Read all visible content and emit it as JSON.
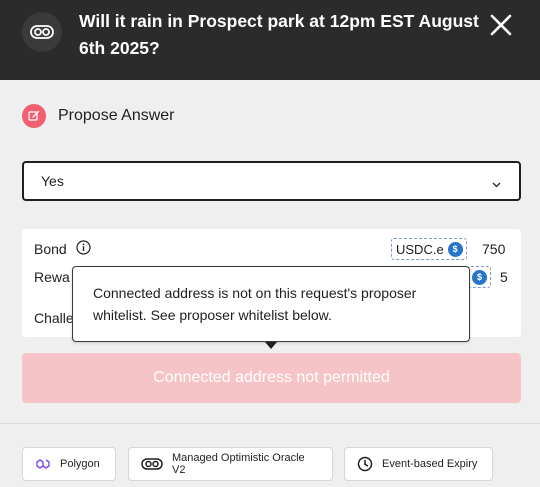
{
  "header": {
    "title": "Will it rain in Prospect park at 12pm EST August 6th 2025?",
    "logo_icon": "oracle-logo-icon",
    "close_icon": "close-icon"
  },
  "propose": {
    "label": "Propose Answer",
    "icon": "pencil-square-icon",
    "icon_color": "#f06070"
  },
  "answer_select": {
    "value": "Yes"
  },
  "info": {
    "bond_label": "Bond",
    "bond_token": "USDC.e",
    "bond_amount": "750",
    "reward_label": "Rewa",
    "reward_amount": "5",
    "challenge_label": "Challe"
  },
  "tooltip": {
    "text": "Connected address is not on this request's proposer whitelist. See proposer whitelist below."
  },
  "submit": {
    "label": "Connected address not permitted",
    "bg_color": "#f6c4c7"
  },
  "chips": [
    {
      "label": "Polygon",
      "icon": "polygon-icon"
    },
    {
      "label": "Managed Optimistic Oracle V2",
      "icon": "oracle-icon"
    },
    {
      "label": "Event-based Expiry",
      "icon": "clock-icon"
    }
  ],
  "colors": {
    "header_bg": "#2b2b2b",
    "page_bg": "#efefef",
    "usdc_blue": "#2775ca"
  }
}
